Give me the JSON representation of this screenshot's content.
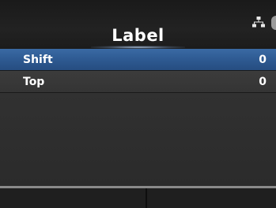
{
  "header": {
    "title": "Label",
    "status_icons": [
      "network-icon"
    ]
  },
  "menu": {
    "items": [
      {
        "label": "Shift",
        "value": "0",
        "selected": true
      },
      {
        "label": "Top",
        "value": "0",
        "selected": false
      }
    ]
  },
  "softkeys": {
    "left_label": "",
    "right_label": ""
  },
  "colors": {
    "selected_row": "#2e5a92",
    "background": "#2b2b2b",
    "text": "#ffffff"
  }
}
